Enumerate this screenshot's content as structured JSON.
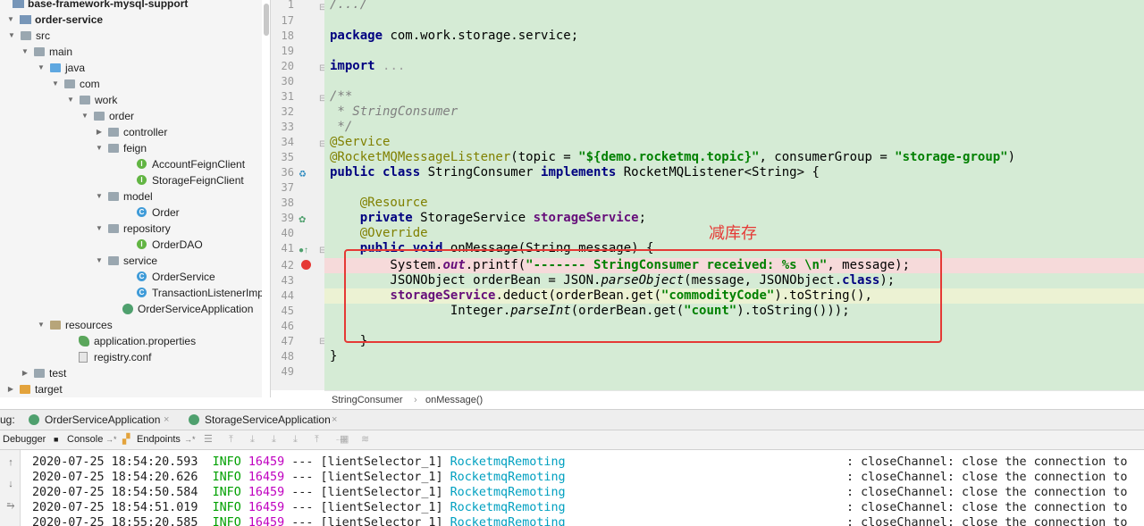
{
  "tree": {
    "items": [
      {
        "label": "base-framework-mysql-support",
        "icon": "module-icon",
        "arrow": "",
        "bold": true
      },
      {
        "label": "order-service",
        "icon": "module-icon",
        "arrow": "expanded",
        "bold": true
      },
      {
        "label": "src",
        "icon": "folder-icon",
        "arrow": "expanded"
      },
      {
        "label": "main",
        "icon": "folder-icon",
        "arrow": "expanded"
      },
      {
        "label": "java",
        "icon": "source-folder-icon",
        "arrow": "expanded"
      },
      {
        "label": "com",
        "icon": "package-icon",
        "arrow": "expanded"
      },
      {
        "label": "work",
        "icon": "package-icon",
        "arrow": "expanded"
      },
      {
        "label": "order",
        "icon": "package-icon",
        "arrow": "expanded"
      },
      {
        "label": "controller",
        "icon": "package-icon",
        "arrow": "collapsed"
      },
      {
        "label": "feign",
        "icon": "package-icon",
        "arrow": "expanded"
      },
      {
        "label": "AccountFeignClient",
        "icon": "interface-icon",
        "arrow": ""
      },
      {
        "label": "StorageFeignClient",
        "icon": "interface-icon",
        "arrow": ""
      },
      {
        "label": "model",
        "icon": "package-icon",
        "arrow": "expanded"
      },
      {
        "label": "Order",
        "icon": "class-icon",
        "arrow": ""
      },
      {
        "label": "repository",
        "icon": "package-icon",
        "arrow": "expanded"
      },
      {
        "label": "OrderDAO",
        "icon": "interface-icon",
        "arrow": ""
      },
      {
        "label": "service",
        "icon": "package-icon",
        "arrow": "expanded"
      },
      {
        "label": "OrderService",
        "icon": "class-icon",
        "arrow": ""
      },
      {
        "label": "TransactionListenerImpl",
        "icon": "class-icon",
        "arrow": ""
      },
      {
        "label": "OrderServiceApplication",
        "icon": "spring-boot-app-icon",
        "arrow": ""
      },
      {
        "label": "resources",
        "icon": "resources-folder-icon",
        "arrow": "expanded"
      },
      {
        "label": "application.properties",
        "icon": "properties-file-icon",
        "arrow": ""
      },
      {
        "label": "registry.conf",
        "icon": "config-file-icon",
        "arrow": ""
      },
      {
        "label": "test",
        "icon": "folder-icon",
        "arrow": "collapsed"
      },
      {
        "label": "target",
        "icon": "excluded-folder-icon",
        "arrow": "collapsed"
      }
    ]
  },
  "editor": {
    "line_numbers": [
      "1",
      "17",
      "18",
      "19",
      "20",
      "30",
      "31",
      "32",
      "33",
      "34",
      "35",
      "36",
      "37",
      "38",
      "39",
      "40",
      "41",
      "42",
      "43",
      "44",
      "45",
      "46",
      "47",
      "48",
      "49"
    ],
    "annotation_text": "减库存"
  },
  "breadcrumb": {
    "class_name": "StringConsumer",
    "method_name": "onMessage()"
  },
  "run_tabs": {
    "prefix": "ug:",
    "tabs": [
      {
        "label": "OrderServiceApplication"
      },
      {
        "label": "StorageServiceApplication"
      }
    ]
  },
  "debug_toolbar": {
    "debugger_label": "Debugger",
    "console_label": "Console",
    "endpoints_label": "Endpoints"
  },
  "console": {
    "lines": [
      {
        "ts": "2020-07-25 18:54:20.593",
        "level": "INFO",
        "pid": "16459",
        "sep": "---",
        "thread": "[lientSelector_1]",
        "logger": "RocketmqRemoting",
        "message": ": closeChannel: close the connection to"
      },
      {
        "ts": "2020-07-25 18:54:20.626",
        "level": "INFO",
        "pid": "16459",
        "sep": "---",
        "thread": "[lientSelector_1]",
        "logger": "RocketmqRemoting",
        "message": ": closeChannel: close the connection to"
      },
      {
        "ts": "2020-07-25 18:54:50.584",
        "level": "INFO",
        "pid": "16459",
        "sep": "---",
        "thread": "[lientSelector_1]",
        "logger": "RocketmqRemoting",
        "message": ": closeChannel: close the connection to"
      },
      {
        "ts": "2020-07-25 18:54:51.019",
        "level": "INFO",
        "pid": "16459",
        "sep": "---",
        "thread": "[lientSelector_1]",
        "logger": "RocketmqRemoting",
        "message": ": closeChannel: close the connection to"
      },
      {
        "ts": "2020-07-25 18:55:20.585",
        "level": "INFO",
        "pid": "16459",
        "sep": "---",
        "thread": "[lientSelector_1]",
        "logger": "RocketmqRemoting",
        "message": ": closeChannel: close the connection to"
      }
    ]
  },
  "colors": {
    "editor_bg": "#d5ebd5",
    "breakpoint_line": "#f6dada",
    "highlight_box": "#e53935"
  }
}
